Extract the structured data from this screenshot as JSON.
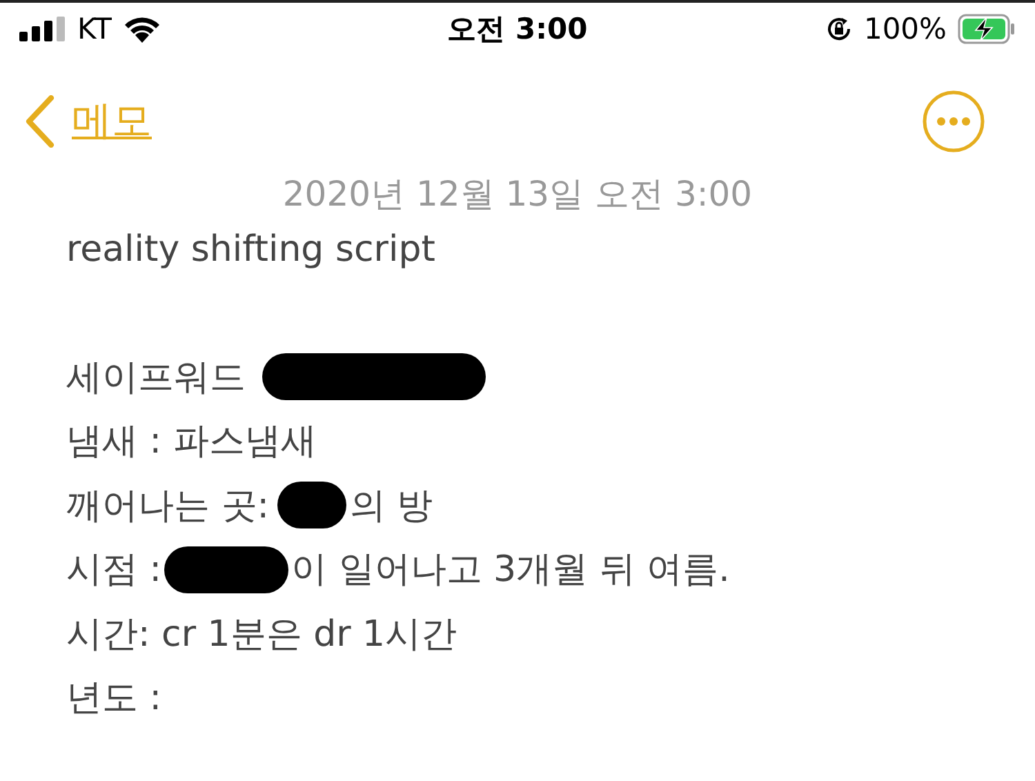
{
  "status_bar": {
    "carrier": "KT",
    "time": "오전 3:00",
    "battery": "100%",
    "charging": true
  },
  "nav": {
    "back_label": "메모"
  },
  "note": {
    "date": "2020년 12월 13일 오전 3:00",
    "title": "reality shifting script",
    "lines": [
      {
        "segments": [
          {
            "kind": "text",
            "text": "세이프워드 "
          },
          {
            "kind": "redaction-long"
          }
        ]
      },
      {
        "segments": [
          {
            "kind": "text",
            "text": "냄새 : 파스냄새"
          }
        ]
      },
      {
        "segments": [
          {
            "kind": "text",
            "text": "깨어나는 곳: "
          },
          {
            "kind": "redaction-short"
          },
          {
            "kind": "text",
            "text": "의 방"
          }
        ]
      },
      {
        "segments": [
          {
            "kind": "text",
            "text": "시점 :"
          },
          {
            "kind": "redaction-medium"
          },
          {
            "kind": "text",
            "text": "이 일어나고 3개월 뒤 여름."
          }
        ]
      },
      {
        "segments": [
          {
            "kind": "text",
            "text": "시간: cr 1분은 dr 1시간"
          }
        ]
      },
      {
        "segments": [
          {
            "kind": "text",
            "text": "년도 :"
          }
        ]
      }
    ]
  }
}
